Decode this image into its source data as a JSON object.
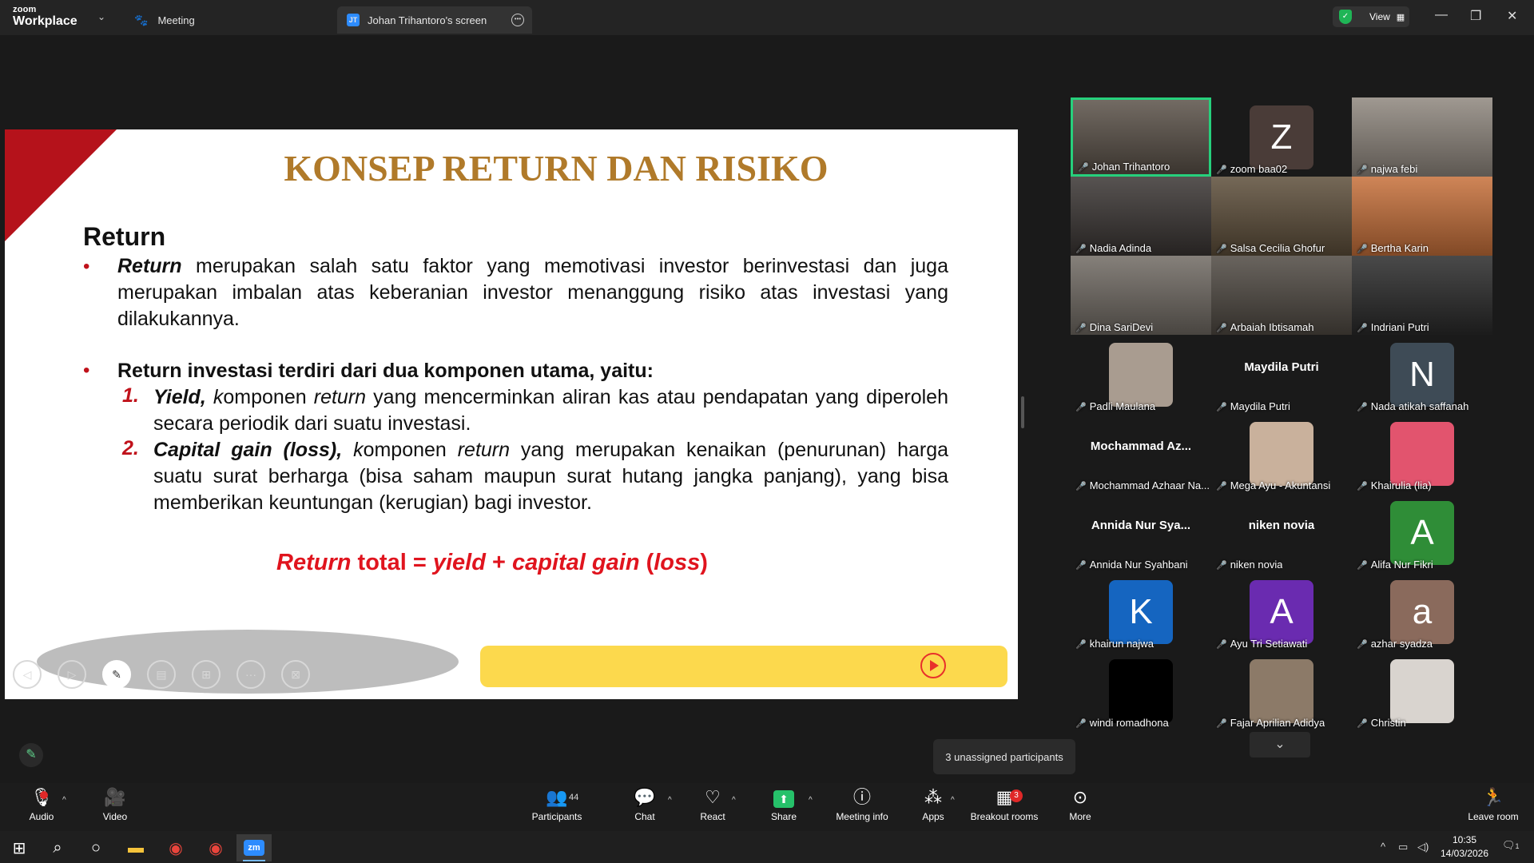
{
  "app": {
    "logo_top": "zoom",
    "logo_bottom": "Workplace",
    "tab_meeting": "Meeting",
    "tab_screen_badge": "JT",
    "tab_screen": "Johan Trihantoro's screen",
    "view_label": "View"
  },
  "slide": {
    "title": "KONSEP RETURN DAN RISIKO",
    "section_heading": "Return",
    "bullet1_lead": "Return",
    "bullet1_text": " merupakan salah satu faktor yang memotivasi investor berinvestasi dan juga merupakan imbalan atas keberanian investor menanggung risiko atas investasi yang dilakukannya.",
    "bullet2_text": "Return investasi terdiri dari dua komponen utama, yaitu:",
    "item1_num": "1.",
    "item1_lead": "Yield, ",
    "item1_k": "k",
    "item1_a": "omponen ",
    "item1_ret": "return",
    "item1_b": " yang mencerminkan aliran kas atau pendapatan yang diperoleh secara periodik dari suatu investasi.",
    "item2_num": "2.",
    "item2_lead": "Capital gain (loss), ",
    "item2_k": "k",
    "item2_a": "omponen ",
    "item2_ret": "return",
    "item2_b": " yang merupakan kenaikan (penurunan) harga suatu surat berharga (bisa saham maupun surat hutang jangka panjang), yang bisa memberikan keuntungan (kerugian) bagi investor.",
    "formula_a": "Return",
    "formula_b": " total = ",
    "formula_c": "yield",
    "formula_d": " + ",
    "formula_e": "capital gain",
    "formula_f": " (",
    "formula_g": "loss",
    "formula_h": ")",
    "bullet_char": "•"
  },
  "gallery": {
    "tiles": [
      {
        "name": "Johan Trihantoro",
        "kind": "photo",
        "color": "#5a5148"
      },
      {
        "name": "zoom baa02",
        "kind": "avatar",
        "letter": "Z",
        "color": "#4a3c38"
      },
      {
        "name": "najwa febi",
        "kind": "photo",
        "color": "#8f877e"
      },
      {
        "name": "Nadia Adinda",
        "kind": "photo",
        "color": "#3a3533"
      },
      {
        "name": "Salsa Cecilia Ghofur",
        "kind": "photo",
        "color": "#5d4e3a"
      },
      {
        "name": "Bertha Karin",
        "kind": "photo",
        "color": "#c7703a"
      },
      {
        "name": "Dina SariDevi",
        "kind": "photo",
        "color": "#706a63"
      },
      {
        "name": "Arbaiah Ibtisamah",
        "kind": "photo",
        "color": "#4f4942"
      },
      {
        "name": "Indriani Putri",
        "kind": "photo",
        "color": "#2a2a2a"
      },
      {
        "name": "Padli Maulana",
        "kind": "small-photo",
        "color": "#a99c90"
      },
      {
        "name": "Maydila Putri",
        "kind": "name",
        "display": "Maydila Putri"
      },
      {
        "name": "Nada atikah saffanah",
        "kind": "avatar",
        "letter": "N",
        "color": "#3e4b56"
      },
      {
        "name": "Mochammad Azhaar Na...",
        "kind": "name",
        "display": "Mochammad Az..."
      },
      {
        "name": "Mega Ayu - Akuntansi",
        "kind": "small-photo",
        "color": "#c9b19c"
      },
      {
        "name": "Khairulia (lia)",
        "kind": "small-photo",
        "color": "#e2546e"
      },
      {
        "name": "Annida Nur Syahbani",
        "kind": "name",
        "display": "Annida Nur Sya..."
      },
      {
        "name": "niken novia",
        "kind": "name",
        "display": "niken novia"
      },
      {
        "name": "Alifa Nur Fikri",
        "kind": "avatar",
        "letter": "A",
        "color": "#2f8d37"
      },
      {
        "name": "khairun najwa",
        "kind": "avatar",
        "letter": "K",
        "color": "#1565c0"
      },
      {
        "name": "Ayu Tri Setiawati",
        "kind": "avatar",
        "letter": "A",
        "color": "#6a2bb0"
      },
      {
        "name": "azhar syadza",
        "kind": "avatar",
        "letter": "a",
        "color": "#8a6a5c"
      },
      {
        "name": "windi romadhona",
        "kind": "small-photo",
        "color": "#000000"
      },
      {
        "name": "Fajar Aprilian Adidya",
        "kind": "small-photo",
        "color": "#8c7a68"
      },
      {
        "name": "Christin",
        "kind": "small-photo",
        "color": "#d9d4cf"
      }
    ],
    "unassigned": "3 unassigned participants",
    "scroll_down": "⌄"
  },
  "controls": {
    "audio": "Audio",
    "video": "Video",
    "participants": "Participants",
    "participants_count": "44",
    "chat": "Chat",
    "react": "React",
    "share": "Share",
    "meeting_info": "Meeting info",
    "apps": "Apps",
    "breakout": "Breakout rooms",
    "breakout_badge": "3",
    "more": "More",
    "leave": "Leave room"
  },
  "taskbar": {
    "time": "10:35",
    "date": "14/03/2026",
    "notif_count": "1"
  }
}
